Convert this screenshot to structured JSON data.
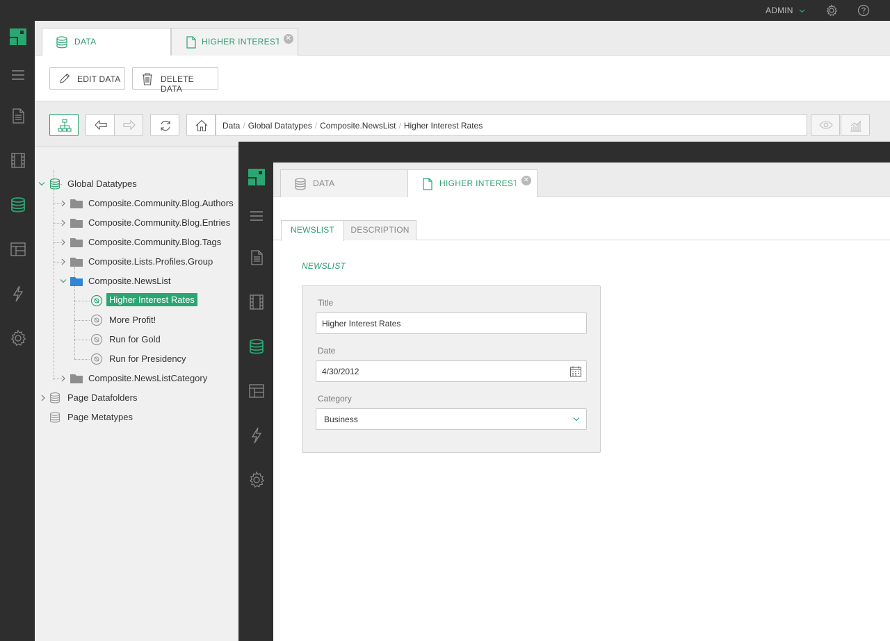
{
  "header": {
    "user": "ADMIN"
  },
  "main": {
    "tabs": [
      {
        "label": "DATA",
        "icon": "database-icon"
      },
      {
        "label": "HIGHER INTEREST RA",
        "icon": "document-icon"
      }
    ],
    "toolbar": {
      "edit_label": "EDIT DATA",
      "delete_label": "DELETE DATA"
    },
    "breadcrumb": [
      "Data",
      "Global Datatypes",
      "Composite.NewsList",
      "Higher Interest Rates"
    ]
  },
  "tree": {
    "root": "Global Datatypes",
    "folders": [
      "Composite.Community.Blog.Authors",
      "Composite.Community.Blog.Entries",
      "Composite.Community.Blog.Tags",
      "Composite.Lists.Profiles.Group",
      "Composite.NewsList"
    ],
    "items": [
      "Higher Interest Rates",
      "More Profit!",
      "Run for Gold",
      "Run for Presidency"
    ],
    "folder_after": "Composite.NewsListCategory",
    "page_datafolders": "Page Datafolders",
    "page_metatypes": "Page Metatypes"
  },
  "editor": {
    "tabs": [
      {
        "label": "DATA"
      },
      {
        "label": "HIGHER INTEREST RA"
      }
    ],
    "content_tabs": [
      "NEWSLIST",
      "DESCRIPTION"
    ],
    "section_title": "NEWSLIST",
    "fields": {
      "title_label": "Title",
      "title_value": "Higher Interest Rates",
      "date_label": "Date",
      "date_value": "4/30/2012",
      "category_label": "Category",
      "category_value": "Business"
    }
  },
  "colors": {
    "accent": "#2e9d72",
    "selected": "#2aa672",
    "sidebar": "#2e2e2e"
  }
}
